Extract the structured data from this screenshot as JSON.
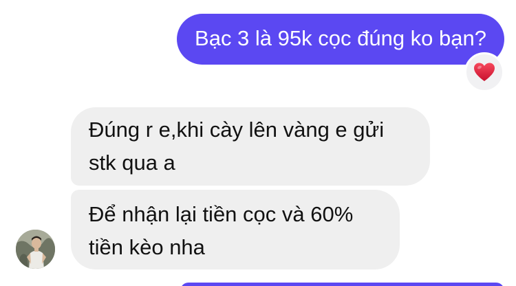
{
  "messages": {
    "outgoing": {
      "text": "Bạc 3 là 95k cọc đúng ko bạn?",
      "reaction_icon": "red-heart-icon"
    },
    "incoming": [
      {
        "line1": "Đúng r e,khi cày lên vàng e gửi",
        "line2": "stk qua a"
      },
      {
        "line1": "Để nhận lại tiền cọc và 60%",
        "line2": "tiền kèo nha"
      }
    ]
  },
  "colors": {
    "outgoing_bubble": "#5b48f2",
    "incoming_bubble": "#efefef",
    "heart": "#e0243a",
    "background": "#ffffff"
  },
  "icons": {
    "reaction": "heart-icon",
    "avatar": "contact-avatar"
  }
}
